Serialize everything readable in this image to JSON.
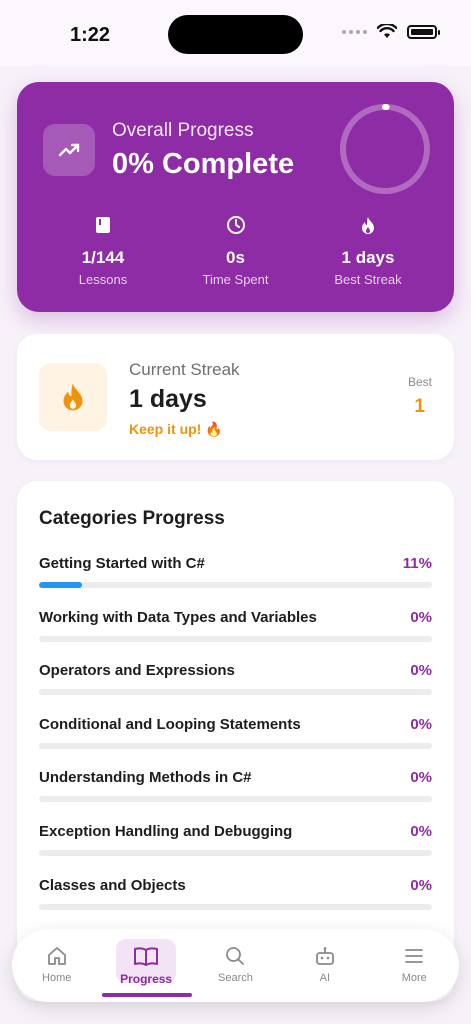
{
  "status": {
    "time": "1:22"
  },
  "overall": {
    "label": "Overall Progress",
    "value": "0% Complete",
    "ring_progress": 0,
    "stats": [
      {
        "icon": "book-icon",
        "value": "1/144",
        "label": "Lessons"
      },
      {
        "icon": "clock-icon",
        "value": "0s",
        "label": "Time Spent"
      },
      {
        "icon": "flame-icon",
        "value": "1 days",
        "label": "Best Streak"
      }
    ]
  },
  "streak": {
    "title": "Current Streak",
    "value": "1 days",
    "note": "Keep it up! 🔥",
    "best_label": "Best",
    "best_value": "1"
  },
  "categories": {
    "title": "Categories Progress",
    "items": [
      {
        "name": "Getting Started with C#",
        "percent_label": "11%",
        "progress": 0.11
      },
      {
        "name": "Working with Data Types and Variables",
        "percent_label": "0%",
        "progress": 0
      },
      {
        "name": "Operators and Expressions",
        "percent_label": "0%",
        "progress": 0
      },
      {
        "name": "Conditional and Looping Statements",
        "percent_label": "0%",
        "progress": 0
      },
      {
        "name": "Understanding Methods in C#",
        "percent_label": "0%",
        "progress": 0
      },
      {
        "name": "Exception Handling and Debugging",
        "percent_label": "0%",
        "progress": 0
      },
      {
        "name": "Classes and Objects",
        "percent_label": "0%",
        "progress": 0
      },
      {
        "name": "",
        "percent_label": "",
        "progress": 0
      }
    ]
  },
  "tabs": [
    {
      "id": "home",
      "label": "Home",
      "icon": "home-icon",
      "active": false
    },
    {
      "id": "progress",
      "label": "Progress",
      "icon": "book-open-icon",
      "active": true
    },
    {
      "id": "search",
      "label": "Search",
      "icon": "search-icon",
      "active": false
    },
    {
      "id": "ai",
      "label": "AI",
      "icon": "robot-icon",
      "active": false
    },
    {
      "id": "more",
      "label": "More",
      "icon": "menu-icon",
      "active": false
    }
  ],
  "colors": {
    "accent": "#8e2ca5",
    "streak": "#f0930c",
    "category_bar": "#2196f3"
  }
}
